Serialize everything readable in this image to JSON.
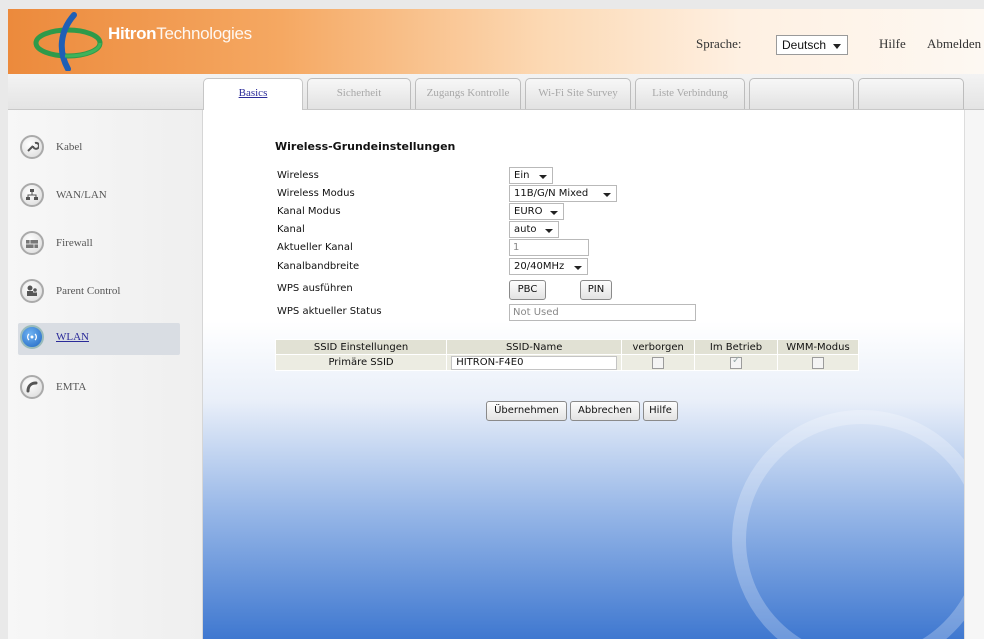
{
  "header": {
    "brand_bold": "Hitron",
    "brand_rest": "Technologies",
    "language_label": "Sprache:",
    "language_value": "Deutsch",
    "help": "Hilfe",
    "logout": "Abmelden",
    "accent_color": "#ec8a3c"
  },
  "tabs": [
    {
      "label": "Basics",
      "active": true
    },
    {
      "label": "Sicherheit",
      "active": false
    },
    {
      "label": "Zugangs Kontrolle",
      "active": false
    },
    {
      "label": "Wi-Fi Site Survey",
      "active": false
    },
    {
      "label": "Liste Verbindung",
      "active": false
    },
    {
      "label": "",
      "active": false
    },
    {
      "label": "",
      "active": false
    }
  ],
  "sidebar": {
    "items": [
      {
        "label": "Kabel",
        "icon": "wrench-icon",
        "active": false
      },
      {
        "label": "WAN/LAN",
        "icon": "network-icon",
        "active": false
      },
      {
        "label": "Firewall",
        "icon": "firewall-icon",
        "active": false
      },
      {
        "label": "Parent Control",
        "icon": "parent-control-icon",
        "active": false
      },
      {
        "label": "WLAN",
        "icon": "wireless-icon",
        "active": true
      },
      {
        "label": "EMTA",
        "icon": "phone-icon",
        "active": false
      }
    ]
  },
  "form": {
    "title": "Wireless-Grundeinstellungen",
    "fields": {
      "wireless": {
        "label": "Wireless",
        "value": "Ein"
      },
      "mode": {
        "label": "Wireless Modus",
        "value": "11B/G/N Mixed"
      },
      "channel_mode": {
        "label": "Kanal Modus",
        "value": "EURO"
      },
      "channel": {
        "label": "Kanal",
        "value": "auto"
      },
      "current_channel": {
        "label": "Aktueller Kanal",
        "value": "1"
      },
      "bandwidth": {
        "label": "Kanalbandbreite",
        "value": "20/40MHz"
      },
      "wps_run": {
        "label": "WPS ausführen",
        "pbc": "PBC",
        "pin": "PIN"
      },
      "wps_status": {
        "label": "WPS aktueller Status",
        "value": "Not Used"
      }
    }
  },
  "ssid_table": {
    "headers": [
      "SSID Einstellungen",
      "SSID-Name",
      "verborgen",
      "Im Betrieb",
      "WMM-Modus"
    ],
    "row": {
      "setting": "Primäre SSID",
      "name": "HITRON-F4E0",
      "hidden": false,
      "in_operation": true,
      "wmm": false
    }
  },
  "actions": {
    "apply": "Übernehmen",
    "cancel": "Abbrechen",
    "help": "Hilfe"
  }
}
